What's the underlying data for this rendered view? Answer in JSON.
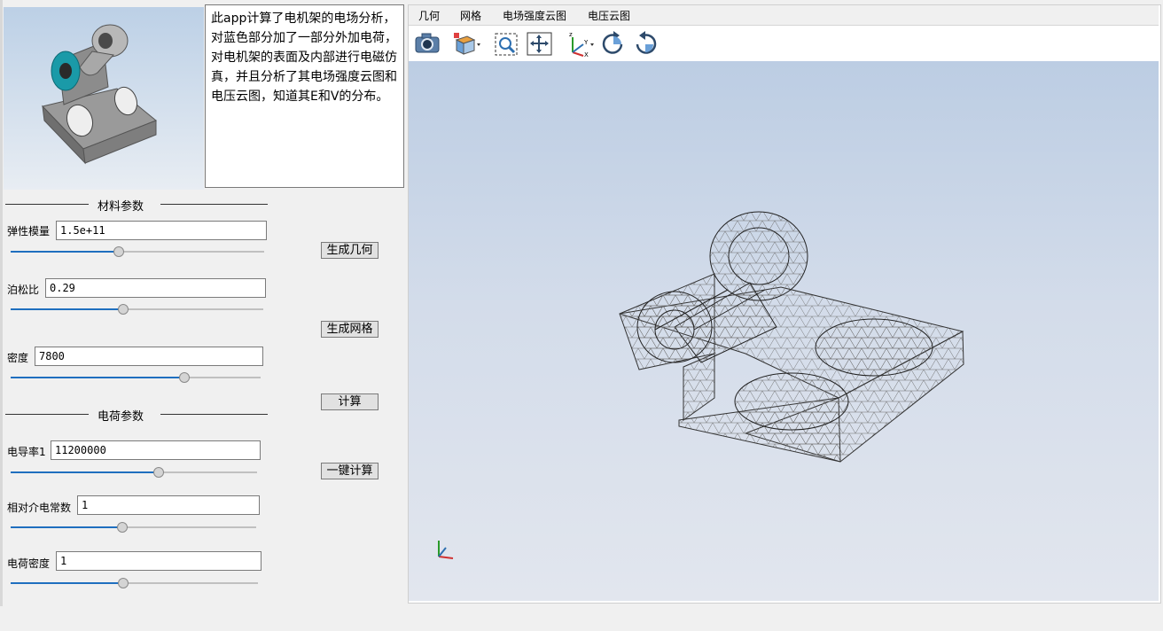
{
  "description": "此app计算了电机架的电场分析，对蓝色部分加了一部分外加电荷，对电机架的表面及内部进行电磁仿真，并且分析了其电场强度云图和电压云图，知道其E和V的分布。",
  "material_group": {
    "title": "材料参数",
    "params": [
      {
        "label": "弹性模量",
        "value": "1.5e+11",
        "level": 0.42
      },
      {
        "label": "泊松比",
        "value": "0.29",
        "level": 0.44
      },
      {
        "label": "密度",
        "value": "7800",
        "level": 0.7
      }
    ]
  },
  "charge_group": {
    "title": "电荷参数",
    "params": [
      {
        "label": "电导率1",
        "value": "11200000",
        "level": 0.6
      },
      {
        "label": "相对介电常数",
        "value": "1",
        "level": 0.45
      },
      {
        "label": "电荷密度",
        "value": "1",
        "level": 0.45
      }
    ]
  },
  "buttons": {
    "gen_geometry": "生成几何",
    "gen_mesh": "生成网格",
    "compute": "计算",
    "one_click": "一键计算"
  },
  "tabs": [
    "几何",
    "网格",
    "电场强度云图",
    "电压云图"
  ],
  "toolbar_icons": [
    "camera-icon",
    "view-cube-icon",
    "zoom-box-icon",
    "fit-view-icon",
    "axes-orientation-icon",
    "rotate-cw-icon",
    "rotate-ccw-icon"
  ],
  "colors": {
    "accent_blue": "#1f6fbf",
    "viewport_top": "#bccde3",
    "viewport_bottom": "#e2e6ee",
    "model_highlight": "#1a9aa8"
  }
}
